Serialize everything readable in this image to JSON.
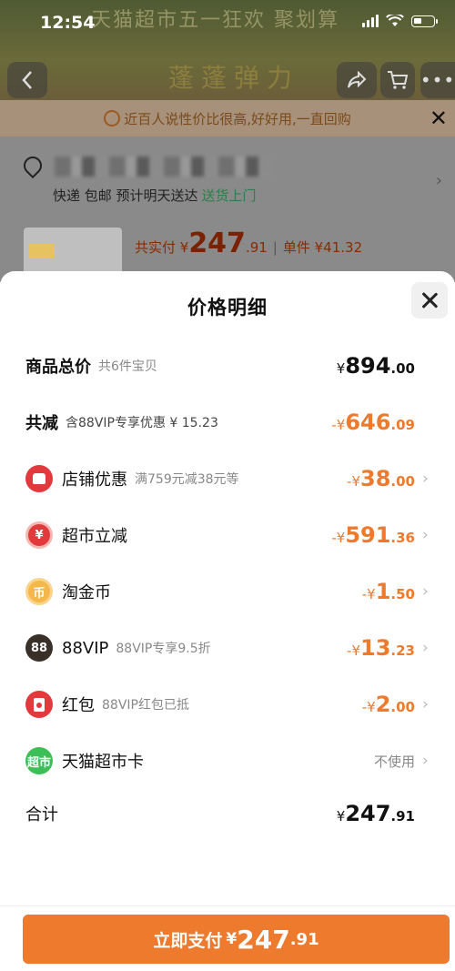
{
  "status": {
    "time": "12:54"
  },
  "background": {
    "banner": "天猫超市五一狂欢 聚划算",
    "shop_name": "蓬蓬弹力",
    "tip": "近百人说性价比很高,好好用,一直回购",
    "shipping": "快递 包邮 预计明天送达",
    "shipping_link": "送货上门",
    "paid_label": "共实付 ¥",
    "paid_int": "247",
    "paid_dec": ".91",
    "unit_label": "单件 ¥41.32"
  },
  "sheet": {
    "title": "价格明细",
    "rows": [
      {
        "label": "商品总价",
        "sub": "共6件宝贝",
        "currency": "¥",
        "int": "894",
        "dec": ".00"
      },
      {
        "label": "共减",
        "sub": "含88VIP专享优惠 ¥ 15.23",
        "currency": "-¥",
        "int": "646",
        "dec": ".09"
      },
      {
        "label": "店铺优惠",
        "sub": "满759元减38元等",
        "currency": "-¥",
        "int": "38",
        "dec": ".00"
      },
      {
        "label": "超市立减",
        "sub": "",
        "currency": "-¥",
        "int": "591",
        "dec": ".36"
      },
      {
        "label": "淘金币",
        "sub": "",
        "currency": "-¥",
        "int": "1",
        "dec": ".50"
      },
      {
        "label": "88VIP",
        "sub": "88VIP专享9.5折",
        "currency": "-¥",
        "int": "13",
        "dec": ".23"
      },
      {
        "label": "红包",
        "sub": "88VIP红包已抵",
        "currency": "-¥",
        "int": "2",
        "dec": ".00"
      },
      {
        "label": "天猫超市卡",
        "sub": "",
        "value_text": "不使用"
      },
      {
        "label": "合计",
        "sub": "",
        "currency": "¥",
        "int": "247",
        "dec": ".91"
      }
    ],
    "icons": {
      "market": "¥",
      "coin": "币",
      "vip": "88",
      "card": "超市"
    }
  },
  "pay_button": {
    "label": "立即支付",
    "currency": "¥",
    "int": "247",
    "dec": ".91"
  },
  "colors": {
    "accent": "#ee7a2e",
    "discount": "#ef7a2c",
    "red_icon": "#e1393c",
    "green_icon": "#3dbf57"
  }
}
